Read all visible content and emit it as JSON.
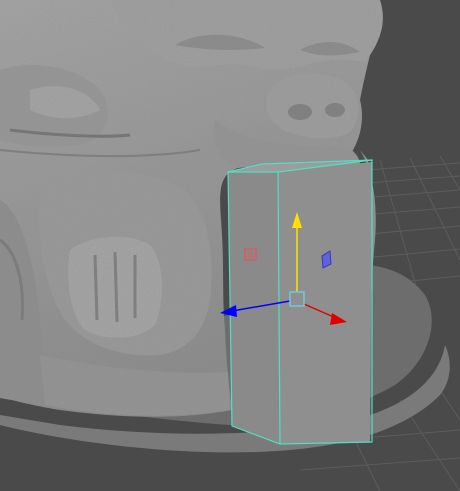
{
  "viewport": {
    "background": "#4a4a4a",
    "grid_color": "#5c5c5c",
    "base_color": "#6d6d6d",
    "sculpt_color": "#9a9a9a",
    "selection_color": "#4fe0c4"
  },
  "manipulator": {
    "x_axis_color": "#e00000",
    "y_axis_color": "#ffe000",
    "z_axis_color": "#0000ff",
    "center_color": "#6fc8e0",
    "plane_xy_color": "#d06060",
    "plane_yz_color": "#6060e0"
  },
  "icons": [
    "move-tool-manipulator",
    "pivot-center-handle"
  ]
}
